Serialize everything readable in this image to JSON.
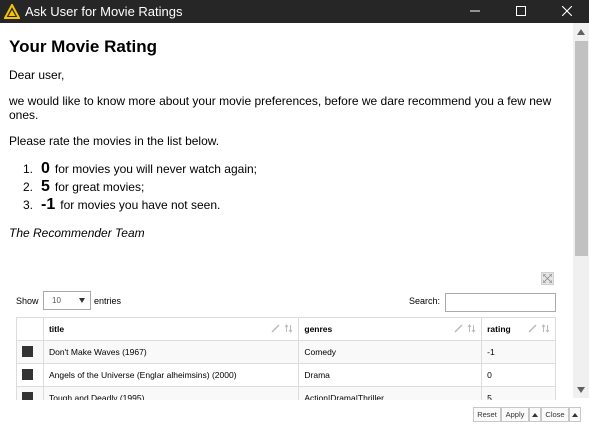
{
  "window": {
    "title": "Ask User for Movie Ratings",
    "icons": {
      "app": "knime-triangle-icon",
      "minimize": "minimize-icon",
      "maximize": "maximize-icon",
      "close": "close-icon"
    },
    "colors": {
      "titlebar": "#262626",
      "app_icon": "#f5c300"
    }
  },
  "content": {
    "heading": "Your Movie Rating",
    "greeting": "Dear user,",
    "intro": "we would like to know more about your movie preferences, before we dare recommend you a few new ones.",
    "instruction": "Please rate the movies in the list below.",
    "rules": [
      {
        "num": "1.",
        "value": "0",
        "text": "for movies you will never watch again;"
      },
      {
        "num": "2.",
        "value": "5",
        "text": "for great movies;"
      },
      {
        "num": "3.",
        "value": "-1",
        "text": "for movies you have not seen."
      }
    ],
    "signature": "The Recommender Team"
  },
  "table_controls": {
    "show_label": "Show",
    "entries_value": "10",
    "entries_label": "entries",
    "search_label": "Search:",
    "search_value": ""
  },
  "table": {
    "columns": [
      "title",
      "genres",
      "rating"
    ],
    "rows": [
      {
        "title": "Don't Make Waves (1967)",
        "genres": "Comedy",
        "rating": "-1"
      },
      {
        "title": "Angels of the Universe (Englar alheimsins) (2000)",
        "genres": "Drama",
        "rating": "0"
      },
      {
        "title": "Tough and Deadly (1995)",
        "genres": "Action|Drama|Thriller",
        "rating": "5"
      }
    ]
  },
  "buttons": {
    "reset": "Reset",
    "apply": "Apply",
    "close": "Close"
  }
}
